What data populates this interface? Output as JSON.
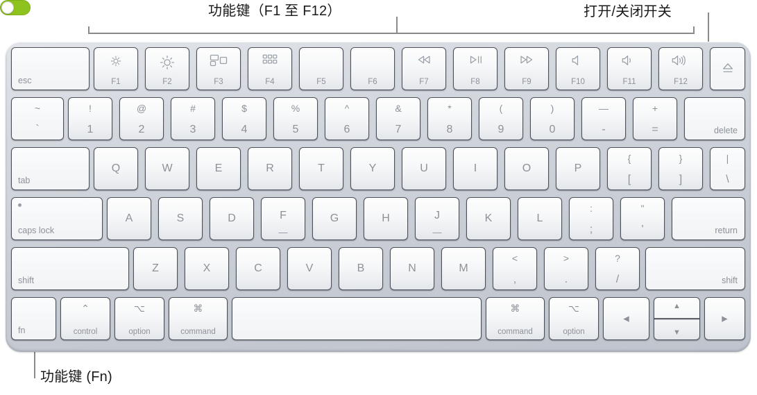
{
  "annotations": {
    "fn_row_label": "功能键（F1 至 F12）",
    "power_switch_label": "打开/关闭开关",
    "fn_key_label": "功能键 (Fn)",
    "toggle_state": "on",
    "toggle_color": "#8ec31f"
  },
  "keyboard": {
    "device": "Magic Keyboard",
    "rows": {
      "function_row": [
        {
          "name": "esc",
          "label": "esc",
          "align": "bl"
        },
        {
          "name": "f1",
          "label": "F1",
          "icon": "brightness-down-icon"
        },
        {
          "name": "f2",
          "label": "F2",
          "icon": "brightness-up-icon"
        },
        {
          "name": "f3",
          "label": "F3",
          "icon": "mission-control-icon"
        },
        {
          "name": "f4",
          "label": "F4",
          "icon": "launchpad-icon"
        },
        {
          "name": "f5",
          "label": "F5",
          "icon": ""
        },
        {
          "name": "f6",
          "label": "F6",
          "icon": ""
        },
        {
          "name": "f7",
          "label": "F7",
          "icon": "rewind-icon"
        },
        {
          "name": "f8",
          "label": "F8",
          "icon": "play-pause-icon"
        },
        {
          "name": "f9",
          "label": "F9",
          "icon": "fast-forward-icon"
        },
        {
          "name": "f10",
          "label": "F10",
          "icon": "mute-icon"
        },
        {
          "name": "f11",
          "label": "F11",
          "icon": "volume-down-icon"
        },
        {
          "name": "f12",
          "label": "F12",
          "icon": "volume-up-icon"
        },
        {
          "name": "eject",
          "label": "",
          "icon": "eject-icon"
        }
      ],
      "number_row": [
        {
          "name": "grave",
          "top": "~",
          "bottom": "`"
        },
        {
          "name": "one",
          "top": "!",
          "bottom": "1"
        },
        {
          "name": "two",
          "top": "@",
          "bottom": "2"
        },
        {
          "name": "three",
          "top": "#",
          "bottom": "3"
        },
        {
          "name": "four",
          "top": "$",
          "bottom": "4"
        },
        {
          "name": "five",
          "top": "%",
          "bottom": "5"
        },
        {
          "name": "six",
          "top": "^",
          "bottom": "6"
        },
        {
          "name": "seven",
          "top": "&",
          "bottom": "7"
        },
        {
          "name": "eight",
          "top": "*",
          "bottom": "8"
        },
        {
          "name": "nine",
          "top": "(",
          "bottom": "9"
        },
        {
          "name": "zero",
          "top": ")",
          "bottom": "0"
        },
        {
          "name": "minus",
          "top": "—",
          "bottom": "-"
        },
        {
          "name": "equal",
          "top": "+",
          "bottom": "="
        },
        {
          "name": "delete",
          "label": "delete",
          "align": "br"
        }
      ],
      "top_row": [
        {
          "name": "tab",
          "label": "tab",
          "align": "bl"
        },
        {
          "name": "q",
          "label": "Q"
        },
        {
          "name": "w",
          "label": "W"
        },
        {
          "name": "e",
          "label": "E"
        },
        {
          "name": "r",
          "label": "R"
        },
        {
          "name": "t",
          "label": "T"
        },
        {
          "name": "y",
          "label": "Y"
        },
        {
          "name": "u",
          "label": "U"
        },
        {
          "name": "i",
          "label": "I"
        },
        {
          "name": "o",
          "label": "O"
        },
        {
          "name": "p",
          "label": "P"
        },
        {
          "name": "bracket-left",
          "top": "{",
          "bottom": "["
        },
        {
          "name": "bracket-right",
          "top": "}",
          "bottom": "]"
        },
        {
          "name": "backslash",
          "top": "|",
          "bottom": "\\"
        }
      ],
      "home_row": [
        {
          "name": "caps-lock",
          "label": "caps lock",
          "align": "bl",
          "indicator": true
        },
        {
          "name": "a",
          "label": "A"
        },
        {
          "name": "s",
          "label": "S"
        },
        {
          "name": "d",
          "label": "D"
        },
        {
          "name": "f",
          "label": "F",
          "homing": true
        },
        {
          "name": "g",
          "label": "G"
        },
        {
          "name": "h",
          "label": "H"
        },
        {
          "name": "j",
          "label": "J",
          "homing": true
        },
        {
          "name": "k",
          "label": "K"
        },
        {
          "name": "l",
          "label": "L"
        },
        {
          "name": "semicolon",
          "top": ":",
          "bottom": ";"
        },
        {
          "name": "quote",
          "top": "\"",
          "bottom": "'"
        },
        {
          "name": "return",
          "label": "return",
          "align": "br"
        }
      ],
      "shift_row": [
        {
          "name": "shift-left",
          "label": "shift",
          "align": "bl"
        },
        {
          "name": "z",
          "label": "Z"
        },
        {
          "name": "x",
          "label": "X"
        },
        {
          "name": "c",
          "label": "C"
        },
        {
          "name": "v",
          "label": "V"
        },
        {
          "name": "b",
          "label": "B"
        },
        {
          "name": "n",
          "label": "N"
        },
        {
          "name": "m",
          "label": "M"
        },
        {
          "name": "comma",
          "top": "<",
          "bottom": ","
        },
        {
          "name": "period",
          "top": ">",
          "bottom": "."
        },
        {
          "name": "slash",
          "top": "?",
          "bottom": "/"
        },
        {
          "name": "shift-right",
          "label": "shift",
          "align": "br"
        }
      ],
      "bottom_row": [
        {
          "name": "fn",
          "label": "fn",
          "align": "bl",
          "glyph": ""
        },
        {
          "name": "control",
          "label": "control",
          "align": "bc",
          "glyph": "⌃"
        },
        {
          "name": "option-left",
          "label": "option",
          "align": "bc",
          "glyph": "⌥"
        },
        {
          "name": "command-left",
          "label": "command",
          "align": "bc",
          "glyph": "⌘"
        },
        {
          "name": "space",
          "label": "",
          "align": "bc",
          "glyph": ""
        },
        {
          "name": "command-right",
          "label": "command",
          "align": "bc",
          "glyph": "⌘"
        },
        {
          "name": "option-right",
          "label": "option",
          "align": "bc",
          "glyph": "⌥"
        },
        {
          "name": "arrow-left",
          "label": "",
          "glyph": "◀"
        },
        {
          "name": "arrow-up-down",
          "up": "▲",
          "down": "▼"
        },
        {
          "name": "arrow-right",
          "label": "",
          "glyph": "▶"
        }
      ]
    }
  }
}
